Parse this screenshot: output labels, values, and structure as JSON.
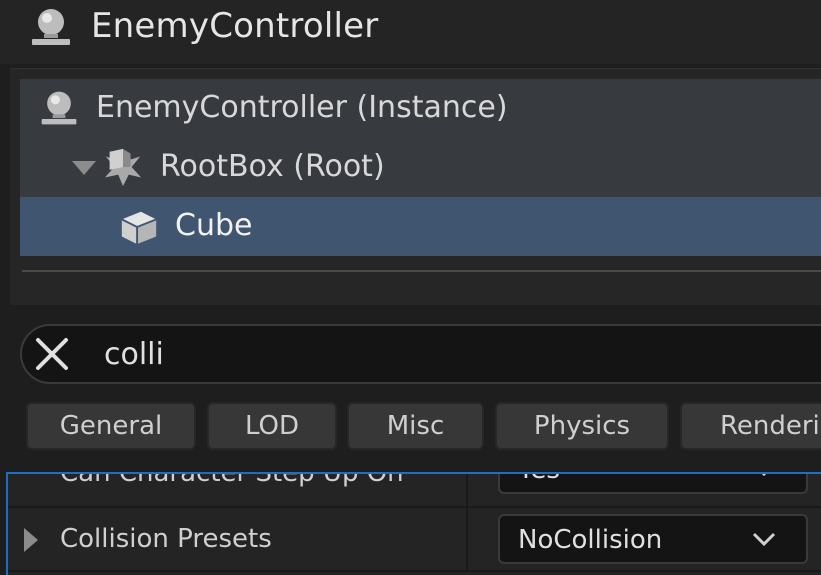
{
  "header": {
    "title": "EnemyController",
    "icon": "blueprint-actor-icon"
  },
  "tree": {
    "items": [
      {
        "label": "EnemyController (Instance)",
        "icon": "blueprint-actor-icon"
      },
      {
        "label": "RootBox (Root)",
        "icon": "root-component-icon",
        "expanded": true
      },
      {
        "label": "Cube",
        "icon": "cube-icon",
        "selected": true
      }
    ]
  },
  "search": {
    "value": "colli",
    "clear_icon": "close-icon"
  },
  "filters": [
    "General",
    "LOD",
    "Misc",
    "Physics",
    "Rendering"
  ],
  "properties": [
    {
      "name": "Can Character Step Up On",
      "value": "Yes"
    },
    {
      "name": "Collision Presets",
      "value": "NoCollision",
      "expandable": true
    }
  ],
  "colors": {
    "selection": "#405570",
    "focus_border": "#1f6fbf",
    "background": "#1e1e1e"
  }
}
